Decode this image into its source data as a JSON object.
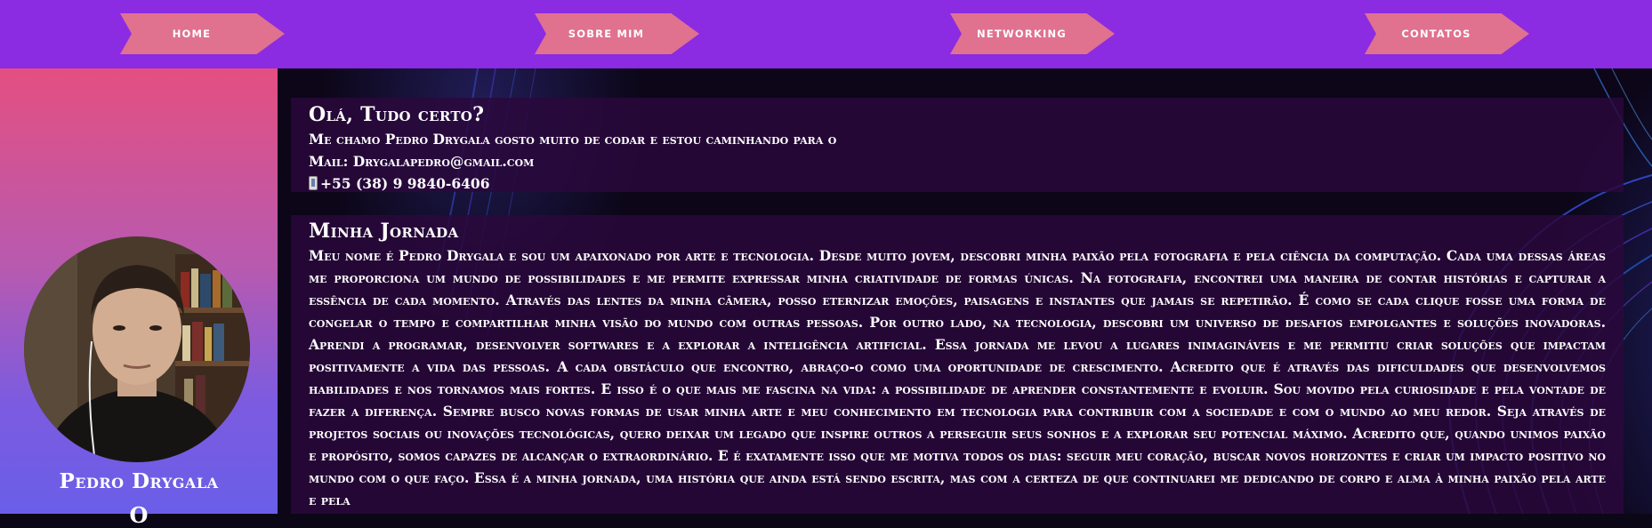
{
  "nav": {
    "items": [
      {
        "label": "HOME"
      },
      {
        "label": "SOBRE MIM"
      },
      {
        "label": "NETWORKING"
      },
      {
        "label": "CONTATOS"
      }
    ]
  },
  "sidebar": {
    "name": "Pedro Drygala",
    "extra": "O"
  },
  "intro": {
    "title": "Olá, Tudo certo?",
    "line1": "Me chamo Pedro Drygala gosto muito de codar e estou caminhando para o",
    "email": "Mail: Drygalapedro@gmail.com",
    "phone": "+55 (38) 9 9840-6406"
  },
  "journey": {
    "title": "Minha Jornada",
    "text": "Meu nome é Pedro Drygala e sou um apaixonado por arte e tecnologia. Desde muito jovem, descobri minha paixão pela fotografia e pela ciência da computação. Cada uma dessas áreas me proporciona um mundo de possibilidades e me permite expressar minha criatividade de formas únicas. Na fotografia, encontrei uma maneira de contar histórias e capturar a essência de cada momento. Através das lentes da minha câmera, posso eternizar emoções, paisagens e instantes que jamais se repetirão. É como se cada clique fosse uma forma de congelar o tempo e compartilhar minha visão do mundo com outras pessoas. Por outro lado, na tecnologia, descobri um universo de desafios empolgantes e soluções inovadoras. Aprendi a programar, desenvolver softwares e a explorar a inteligência artificial. Essa jornada me levou a lugares inimagináveis e me permitiu criar soluções que impactam positivamente a vida das pessoas. A cada obstáculo que encontro, abraço-o como uma oportunidade de crescimento. Acredito que é através das dificuldades que desenvolvemos habilidades e nos tornamos mais fortes. E isso é o que mais me fascina na vida: a possibilidade de aprender constantemente e evoluir. Sou movido pela curiosidade e pela vontade de fazer a diferença. Sempre busco novas formas de usar minha arte e meu conhecimento em tecnologia para contribuir com a sociedade e com o mundo ao meu redor. Seja através de projetos sociais ou inovações tecnológicas, quero deixar um legado que inspire outros a perseguir seus sonhos e a explorar seu potencial máximo. Acredito que, quando unimos paixão e propósito, somos capazes de alcançar o extraordinário. E é exatamente isso que me motiva todos os dias: seguir meu coração, buscar novos horizontes e criar um impacto positivo no mundo com o que faço. Essa é a minha jornada, uma história que ainda está sendo escrita, mas com a certeza de que continuarei me dedicando de corpo e alma à minha paixão pela arte e pela"
  },
  "colors": {
    "nav_bg": "#8b2be2",
    "nav_tab": "#e0718f",
    "sidebar_top": "#e44f81",
    "sidebar_bottom": "#6a5ee8",
    "panel_bg": "#2a083c"
  },
  "icons": {
    "phone": "mobile-phone-icon"
  }
}
